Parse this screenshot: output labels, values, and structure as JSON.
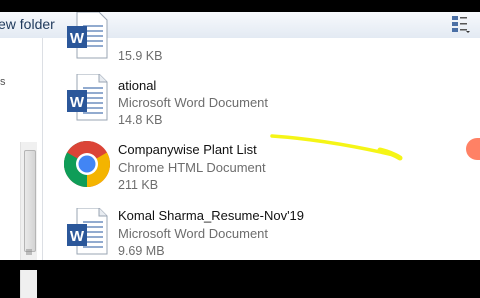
{
  "toolbar": {
    "new_folder_label": "ew folder",
    "view_icon": "view-options-icon"
  },
  "left_pane": {
    "glyph": "s"
  },
  "files": [
    {
      "name": "",
      "type": "",
      "size": "15.9 KB",
      "icon": "word-document-icon"
    },
    {
      "name": "ational",
      "type": "Microsoft Word Document",
      "size": "14.8 KB",
      "icon": "word-document-icon"
    },
    {
      "name": "Companywise Plant List",
      "type": "Chrome HTML Document",
      "size": "211 KB",
      "icon": "chrome-icon"
    },
    {
      "name": "Komal Sharma_Resume-Nov'19",
      "type": "Microsoft Word Document",
      "size": "9.69 MB",
      "icon": "word-document-icon"
    }
  ],
  "colors": {
    "highlighter": "#f5f516",
    "word_blue": "#2b579a",
    "pointer": "#ff6b4a"
  }
}
